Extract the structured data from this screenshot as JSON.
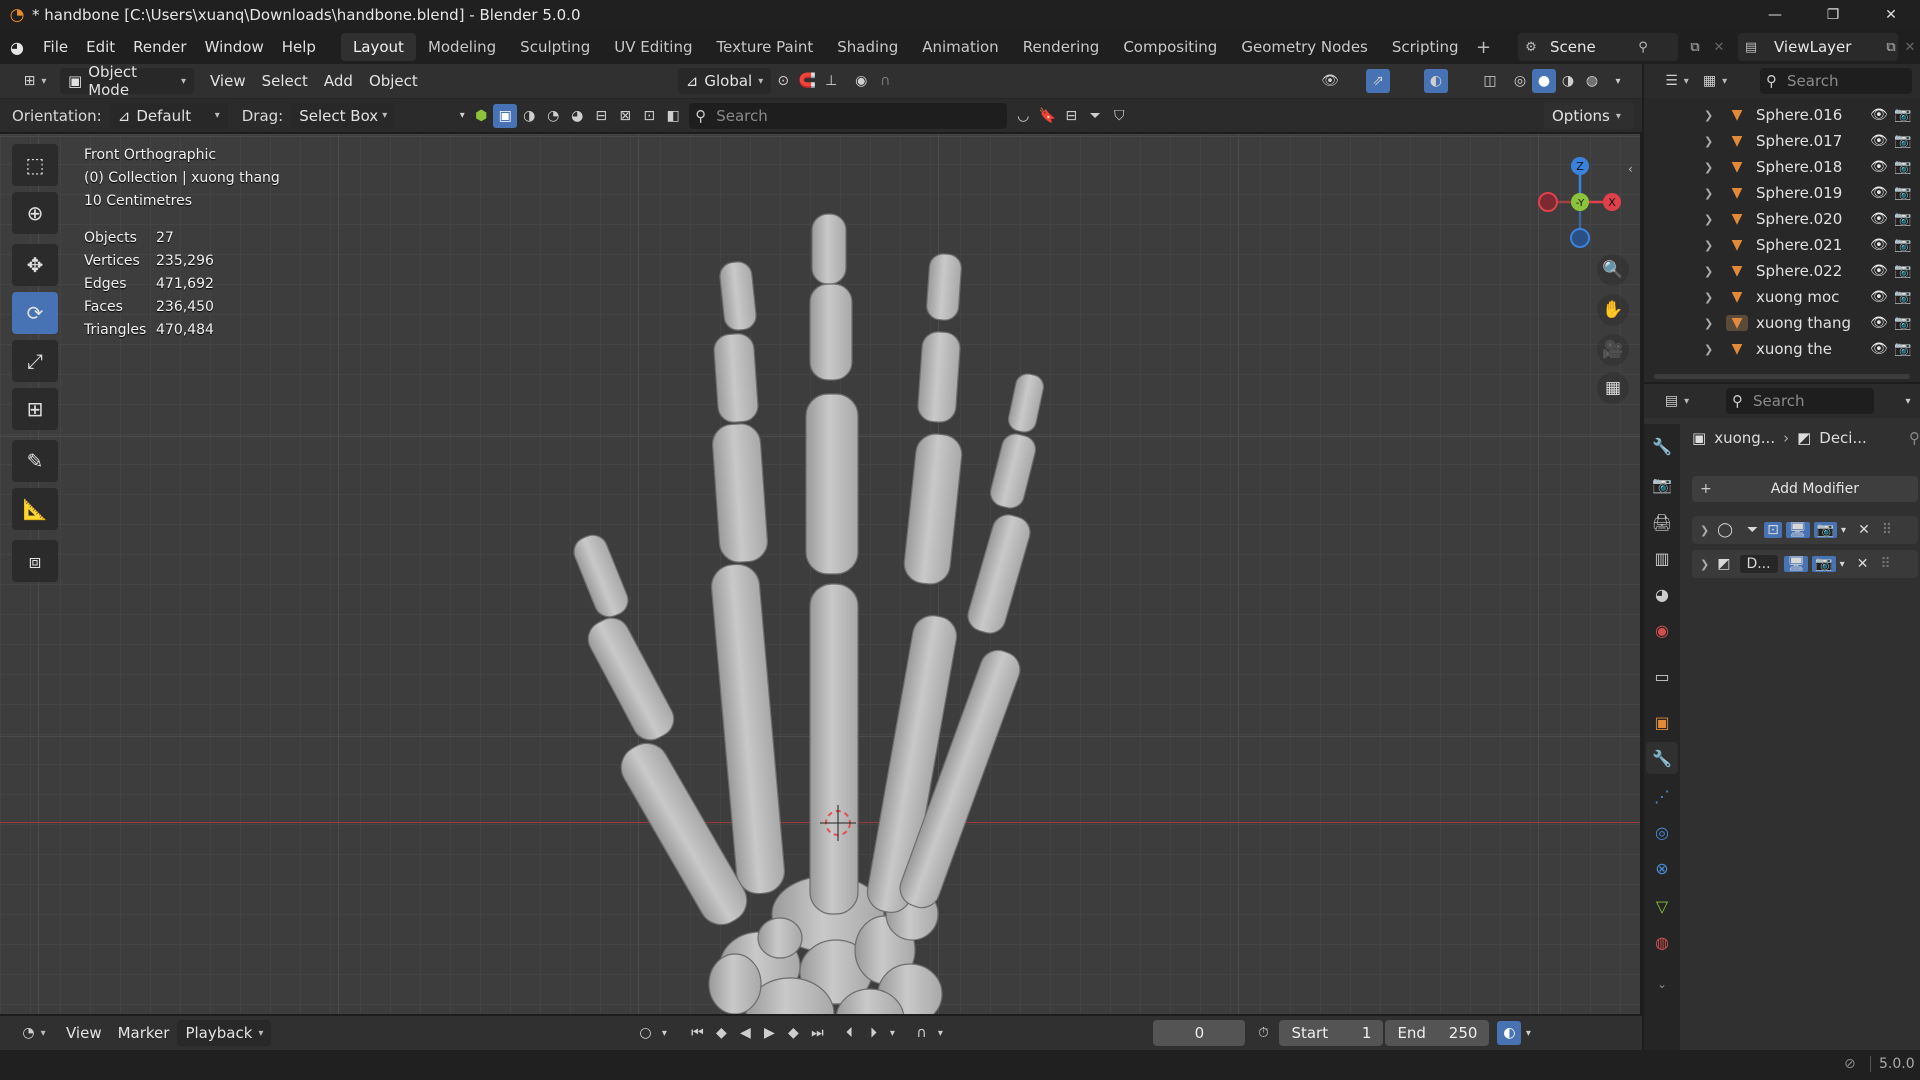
{
  "window": {
    "title": "* handbone [C:\\Users\\xuanq\\Downloads\\handbone.blend] - Blender 5.0.0"
  },
  "menu": [
    "File",
    "Edit",
    "Render",
    "Window",
    "Help"
  ],
  "workspaces": [
    "Layout",
    "Modeling",
    "Sculpting",
    "UV Editing",
    "Texture Paint",
    "Shading",
    "Animation",
    "Rendering",
    "Compositing",
    "Geometry Nodes",
    "Scripting"
  ],
  "scene": {
    "name": "Scene",
    "view_layer": "ViewLayer"
  },
  "viewport_header": {
    "mode": "Object Mode",
    "menus": [
      "View",
      "Select",
      "Add",
      "Object"
    ],
    "transform_orientation": "Global",
    "orientation_label": "Orientation:",
    "orientation_value": "Default",
    "drag_label": "Drag:",
    "drag_value": "Select Box",
    "search_placeholder": "Search",
    "options": "Options"
  },
  "overlay": {
    "view_name": "Front Orthographic",
    "collection": "(0) Collection | xuong thang",
    "scale": "10 Centimetres",
    "stats": [
      {
        "label": "Objects",
        "value": "27"
      },
      {
        "label": "Vertices",
        "value": "235,296"
      },
      {
        "label": "Edges",
        "value": "471,692"
      },
      {
        "label": "Faces",
        "value": "236,450"
      },
      {
        "label": "Triangles",
        "value": "470,484"
      }
    ]
  },
  "gizmo": {
    "z": "Z",
    "y": "-Y",
    "x": "X"
  },
  "outliner": {
    "search_placeholder": "Search",
    "items": [
      "Sphere.016",
      "Sphere.017",
      "Sphere.018",
      "Sphere.019",
      "Sphere.020",
      "Sphere.021",
      "Sphere.022",
      "xuong moc",
      "xuong thang",
      "xuong the"
    ]
  },
  "properties": {
    "search_placeholder": "Search",
    "breadcrumb_object": "xuong...",
    "breadcrumb_modifier": "Deci...",
    "add_modifier": "Add Modifier",
    "modifier2_name": "D..."
  },
  "timeline": {
    "menus": [
      "View",
      "Marker",
      "Playback"
    ],
    "current_frame": "0",
    "start_label": "Start",
    "start_value": "1",
    "end_label": "End",
    "end_value": "250"
  },
  "status": {
    "version": "5.0.0"
  },
  "colors": {
    "accent": "#4772b3",
    "object_orange": "#e08a3a",
    "x_axis": "#e0404b",
    "y_axis": "#8bc43a",
    "z_axis": "#3b82dd"
  }
}
